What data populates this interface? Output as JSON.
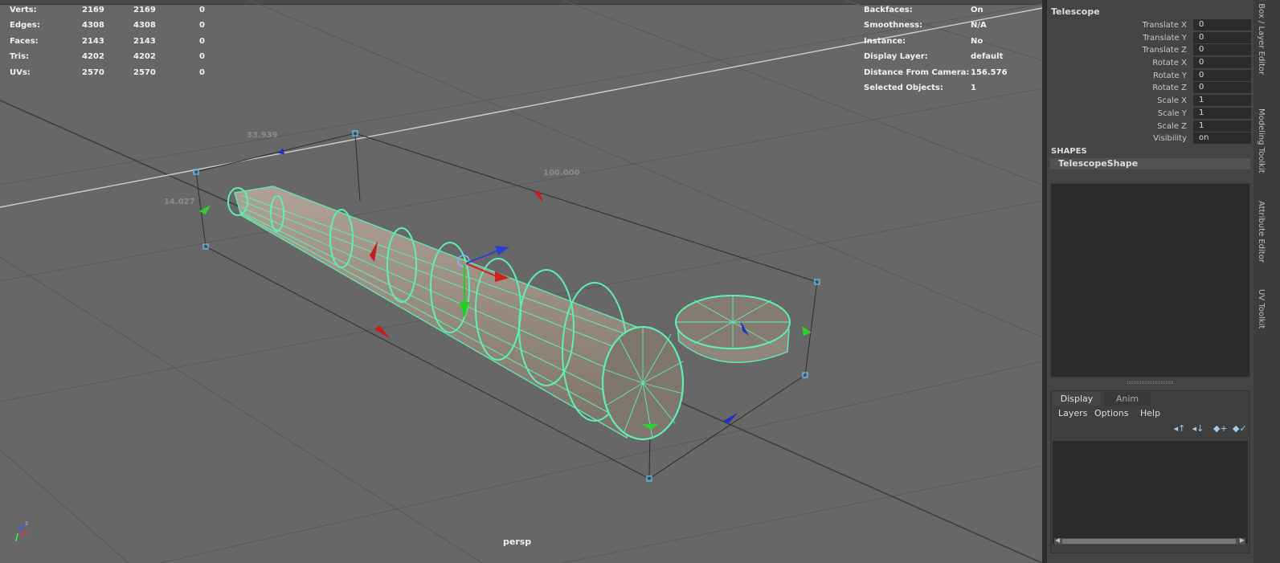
{
  "stats": {
    "rows": [
      {
        "label": "Verts:",
        "a": "2169",
        "b": "2169",
        "c": "0"
      },
      {
        "label": "Edges:",
        "a": "4308",
        "b": "4308",
        "c": "0"
      },
      {
        "label": "Faces:",
        "a": "2143",
        "b": "2143",
        "c": "0"
      },
      {
        "label": "Tris:",
        "a": "4202",
        "b": "4202",
        "c": "0"
      },
      {
        "label": "UVs:",
        "a": "2570",
        "b": "2570",
        "c": "0"
      }
    ]
  },
  "info": {
    "rows": [
      {
        "label": "Backfaces:",
        "value": "On"
      },
      {
        "label": "Smoothness:",
        "value": "N/A"
      },
      {
        "label": "Instance:",
        "value": "No"
      },
      {
        "label": "Display Layer:",
        "value": "default"
      },
      {
        "label": "Distance From Camera:",
        "value": "156.576"
      },
      {
        "label": "Selected Objects:",
        "value": "1"
      }
    ]
  },
  "measurements": {
    "depth": "33.939",
    "width": "100.000",
    "height": "14.027"
  },
  "camera_label": "persp",
  "channel_box": {
    "object_name": "Telescope",
    "attributes": [
      {
        "label": "Translate X",
        "value": "0"
      },
      {
        "label": "Translate Y",
        "value": "0"
      },
      {
        "label": "Translate Z",
        "value": "0"
      },
      {
        "label": "Rotate X",
        "value": "0"
      },
      {
        "label": "Rotate Y",
        "value": "0"
      },
      {
        "label": "Rotate Z",
        "value": "0"
      },
      {
        "label": "Scale X",
        "value": "1"
      },
      {
        "label": "Scale Y",
        "value": "1"
      },
      {
        "label": "Scale Z",
        "value": "1"
      },
      {
        "label": "Visibility",
        "value": "on"
      }
    ],
    "shapes_header": "SHAPES",
    "shape_name": "TelescopeShape"
  },
  "layer_editor": {
    "tabs": [
      "Display",
      "Anim"
    ],
    "menus": [
      "Layers",
      "Options",
      "Help"
    ],
    "icons": [
      "layer-move-up-icon",
      "layer-move-down-icon",
      "new-layer-icon",
      "new-layer-selected-icon"
    ]
  },
  "side_tabs": [
    "Channel Box / Layer Editor",
    "Modeling Toolkit",
    "Attribute Editor",
    "UV Toolkit"
  ],
  "colors": {
    "viewport_bg": "#676767",
    "wireframe": "#5ef0b0",
    "selection_box": "#54c8ff",
    "panel_bg": "#444444",
    "field_bg": "#2b2b2b"
  }
}
